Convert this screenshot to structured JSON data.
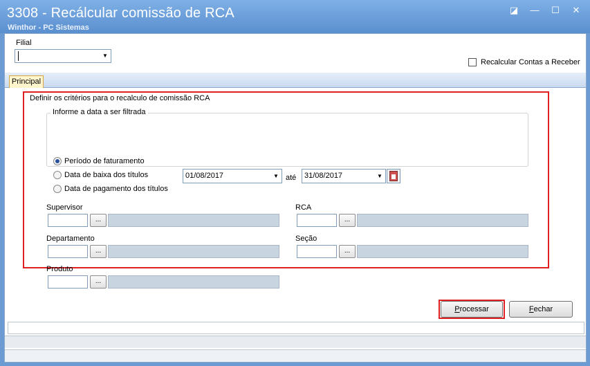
{
  "window": {
    "title": "3308 - Recálcular comissão de RCA",
    "subtitle": "Winthor - PC Sistemas",
    "controls": {
      "restore": "◪",
      "minimize": "—",
      "maximize": "☐",
      "close": "✕"
    }
  },
  "header": {
    "filial_label": "Filial",
    "filial_value": "",
    "recalcular_label": "Recalcular Contas a Receber"
  },
  "tabs": [
    {
      "label": "Principal"
    }
  ],
  "criteria": {
    "group_label": "Definir os critérios para o recalculo de comissão RCA",
    "date_group_label": "Informe a data a ser filtrada",
    "radios": [
      {
        "label": "Período de faturamento",
        "selected": true
      },
      {
        "label": "Data de baixa dos títulos",
        "selected": false
      },
      {
        "label": "Data de pagamento dos títulos",
        "selected": false
      }
    ],
    "date_from": "01/08/2017",
    "date_to_label": "até",
    "date_to": "31/08/2017"
  },
  "fields": {
    "supervisor_label": "Supervisor",
    "rca_label": "RCA",
    "departamento_label": "Departamento",
    "secao_label": "Seção",
    "produto_label": "Produto",
    "dots_label": "..."
  },
  "buttons": {
    "processar_ul": "P",
    "processar_rest": "rocessar",
    "fechar_ul": "F",
    "fechar_rest": "echar"
  }
}
